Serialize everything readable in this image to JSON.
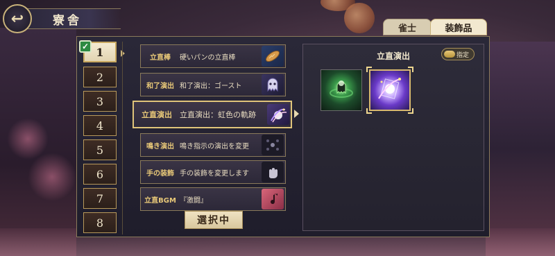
{
  "header": {
    "title": "寮舎",
    "back_icon": "back-arrow-icon"
  },
  "tabs": [
    {
      "label": "雀士",
      "active": false
    },
    {
      "label": "装飾品",
      "active": true
    }
  ],
  "slots": {
    "items": [
      "1",
      "2",
      "3",
      "4",
      "5",
      "6",
      "7",
      "8"
    ],
    "selected": "1",
    "checked": true
  },
  "decorations": [
    {
      "category": "立直棒",
      "description": "硬いパンの立直棒",
      "icon": "bread-icon"
    },
    {
      "category": "和了演出",
      "description": "和了演出：ゴースト",
      "icon": "ghost-icon"
    },
    {
      "category": "立直演出",
      "description": "立直演出：虹色の軌跡",
      "icon": "rainbow-trail-icon",
      "selected": true
    },
    {
      "category": "鳴き演出",
      "description": "鳴き指示の演出を変更",
      "icon": "call-effect-icon"
    },
    {
      "category": "手の装飾",
      "description": "手の装飾を変更します",
      "icon": "hand-icon"
    },
    {
      "category": "立直BGM",
      "description": "『激闘』",
      "icon": "music-icon"
    }
  ],
  "selecting_label": "選択中",
  "detail": {
    "title": "立直演出",
    "designate_label": "指定",
    "options": [
      {
        "icon": "green-ghost-effect-icon",
        "selected": false
      },
      {
        "icon": "rainbow-trail-effect-icon",
        "selected": true
      }
    ]
  }
}
